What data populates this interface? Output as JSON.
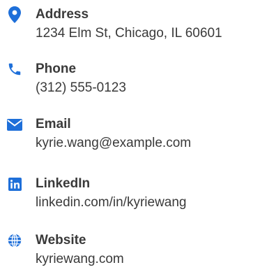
{
  "accent_color": "#1e6fd9",
  "contacts": [
    {
      "icon": "map-pin-icon",
      "label": "Address",
      "value": "1234 Elm St, Chicago, IL 60601"
    },
    {
      "icon": "phone-icon",
      "label": "Phone",
      "value": "(312) 555-0123"
    },
    {
      "icon": "envelope-icon",
      "label": "Email",
      "value": "kyrie.wang@example.com"
    },
    {
      "icon": "linkedin-icon",
      "label": "LinkedIn",
      "value": "linkedin.com/in/kyriewang"
    },
    {
      "icon": "globe-icon",
      "label": "Website",
      "value": "kyriewang.com"
    }
  ]
}
